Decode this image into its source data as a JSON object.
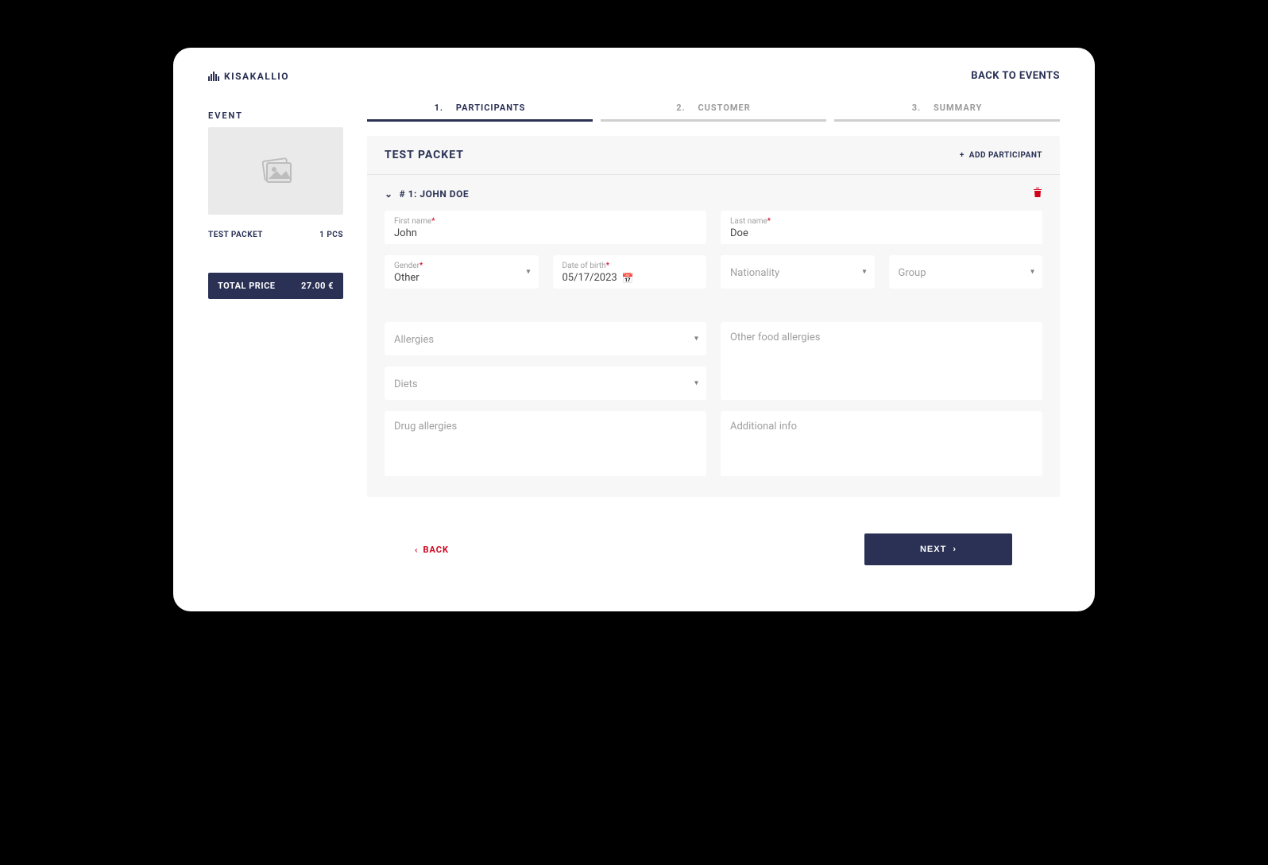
{
  "header": {
    "brand": "KISAKALLIO",
    "back_to_events": "BACK TO EVENTS"
  },
  "sidebar": {
    "label": "EVENT",
    "item_name": "TEST PACKET",
    "item_qty": "1 PCS",
    "total_label": "TOTAL PRICE",
    "total_value": "27.00 €"
  },
  "steps": [
    {
      "num": "1.",
      "label": "PARTICIPANTS"
    },
    {
      "num": "2.",
      "label": "CUSTOMER"
    },
    {
      "num": "3.",
      "label": "SUMMARY"
    }
  ],
  "panel": {
    "title": "TEST PACKET",
    "add": "ADD PARTICIPANT",
    "participant_title": "# 1: JOHN DOE"
  },
  "fields": {
    "first_name_label": "First name",
    "first_name_value": "John",
    "last_name_label": "Last name",
    "last_name_value": "Doe",
    "gender_label": "Gender",
    "gender_value": "Other",
    "dob_label": "Date of birth",
    "dob_value": "05/17/2023",
    "nationality_placeholder": "Nationality",
    "group_placeholder": "Group",
    "allergies": "Allergies",
    "diets": "Diets",
    "other_food": "Other food allergies",
    "drug": "Drug allergies",
    "additional": "Additional info"
  },
  "footer": {
    "back": "BACK",
    "next": "NEXT"
  }
}
